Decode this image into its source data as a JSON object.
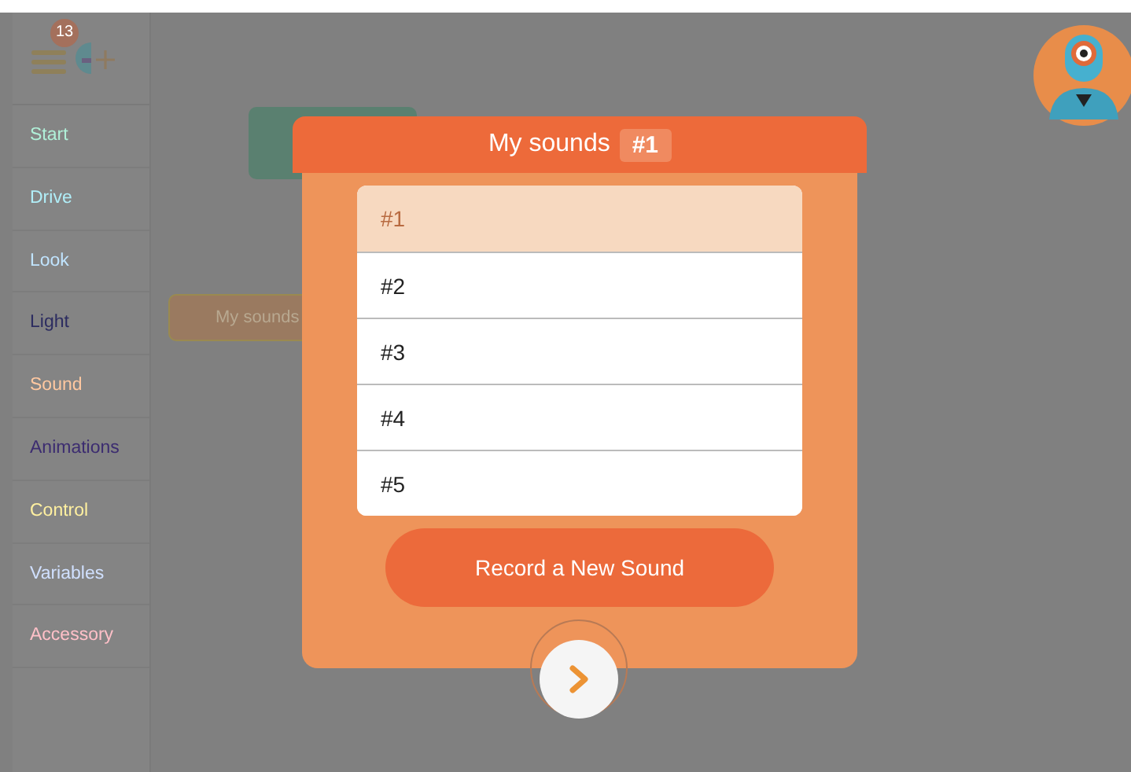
{
  "toolbar": {
    "badge": "13"
  },
  "sidebar": {
    "items": [
      {
        "label": "Start",
        "color": "#b0f0d8"
      },
      {
        "label": "Drive",
        "color": "#b0eef8"
      },
      {
        "label": "Look",
        "color": "#c0e4ff"
      },
      {
        "label": "Light",
        "color": "#2c2c60"
      },
      {
        "label": "Sound",
        "color": "#ffc8a0"
      },
      {
        "label": "Animations",
        "color": "#3c2c70"
      },
      {
        "label": "Control",
        "color": "#fff0a0"
      },
      {
        "label": "Variables",
        "color": "#d0e0ff"
      },
      {
        "label": "Accessory",
        "color": "#ffc0c8"
      }
    ]
  },
  "canvas": {
    "blocks": [
      {
        "kind": "start"
      },
      {
        "kind": "sound",
        "label": "My sounds"
      }
    ]
  },
  "dialog": {
    "title": "My sounds",
    "value_badge": "#1",
    "options": [
      {
        "label": "#1",
        "selected": true
      },
      {
        "label": "#2",
        "selected": false
      },
      {
        "label": "#3",
        "selected": false
      },
      {
        "label": "#4",
        "selected": false
      },
      {
        "label": "#5",
        "selected": false
      }
    ],
    "record_button": "Record a New Sound"
  }
}
